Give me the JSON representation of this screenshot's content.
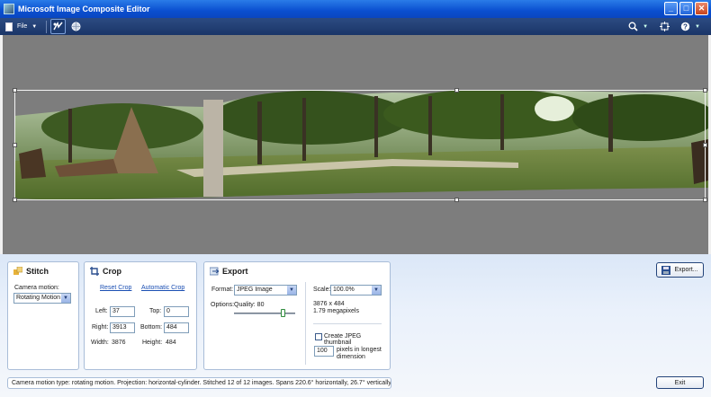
{
  "window": {
    "title": "Microsoft Image Composite Editor"
  },
  "toolbar": {
    "file_label": "File",
    "icons": [
      "stitch-mode-icon",
      "globe-icon"
    ],
    "right_icons": [
      "zoom-icon",
      "fit-to-window-icon",
      "help-icon"
    ]
  },
  "stitch": {
    "title": "Stitch",
    "camera_motion_label": "Camera motion:",
    "camera_motion_value": "Rotating Motion"
  },
  "crop": {
    "title": "Crop",
    "reset_link": "Reset Crop",
    "auto_link": "Automatic Crop",
    "left_label": "Left:",
    "left_value": "37",
    "top_label": "Top:",
    "top_value": "0",
    "right_label": "Right:",
    "right_value": "3913",
    "bottom_label": "Bottom:",
    "bottom_value": "484",
    "width_label": "Width:",
    "width_value": "3876",
    "height_label": "Height:",
    "height_value": "484"
  },
  "export": {
    "title": "Export",
    "format_label": "Format:",
    "format_value": "JPEG Image",
    "options_label": "Options:",
    "quality_label": "Quality: 80",
    "quality_fraction": 0.8,
    "scale_label": "Scale:",
    "scale_value": "100.0%",
    "dimensions": "3876 x 484",
    "megapixels": "1.79 megapixels",
    "thumbnail_label": "Create JPEG thumbnail",
    "thumbnail_checked": false,
    "thumb_size_value": "100",
    "thumb_size_label_1": "pixels in longest",
    "thumb_size_label_2": "dimension",
    "export_button": "Export..."
  },
  "exit_button": "Exit",
  "status": "Camera motion type: rotating motion. Projection: horizontal-cylinder. Stitched 12 of 12 images. Spans 220.6° horizontally, 26.7° vertically.",
  "colors": {
    "titlebar": "#0a4fd0",
    "toolbar": "#1f3c72",
    "canvas": "#7d7d7d",
    "link": "#1b4fb3"
  }
}
